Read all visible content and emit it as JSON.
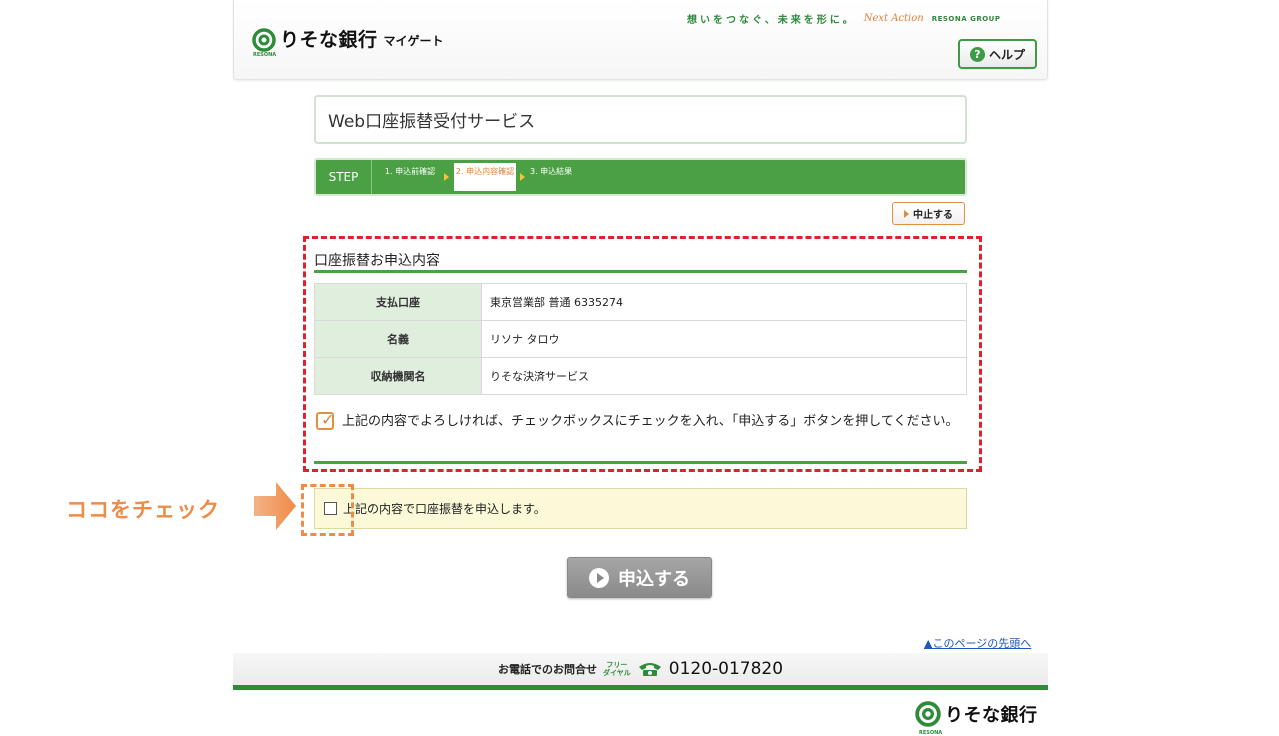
{
  "header": {
    "bank_name": "りそな銀行",
    "service_name": "マイゲート",
    "resona_small": "RESONA",
    "tagline": "想いをつなぐ、未来を形に。",
    "next_action": "Next Action",
    "group": "RESONA GROUP",
    "help_label": "ヘルプ"
  },
  "page_title": "Web口座振替受付サービス",
  "steps": {
    "label": "STEP",
    "items": [
      {
        "label": "1. 申込前確認",
        "active": false
      },
      {
        "label": "2. 申込内容確認",
        "active": true
      },
      {
        "label": "3. 申込結果",
        "active": false
      }
    ]
  },
  "cancel_label": "中止する",
  "section_title": "口座振替お申込内容",
  "details": [
    {
      "label": "支払口座",
      "value": "東京営業部 普通 6335274"
    },
    {
      "label": "名義",
      "value": "リソナ タロウ"
    },
    {
      "label": "収納機関名",
      "value": "りそな決済サービス"
    }
  ],
  "notice_text": "上記の内容でよろしければ、チェックボックスにチェックを入れ、「申込する」ボタンを押してください。",
  "agreement": {
    "label": "上記の内容で口座振替を申込します。",
    "checked": false
  },
  "callout_text": "ココをチェック",
  "submit_label": "申込する",
  "page_top_link": "▲このページの先頭へ",
  "footer": {
    "contact_label": "お電話でのお問合せ",
    "freedial_top": "フリー",
    "freedial_bottom": "ダイヤル",
    "phone": "0120-017820",
    "bank_name": "りそな銀行",
    "resona_small": "RESONA"
  },
  "colors": {
    "brand_green": "#4aa043",
    "accent_orange": "#ef8a47",
    "highlight_red": "#e0202a"
  }
}
